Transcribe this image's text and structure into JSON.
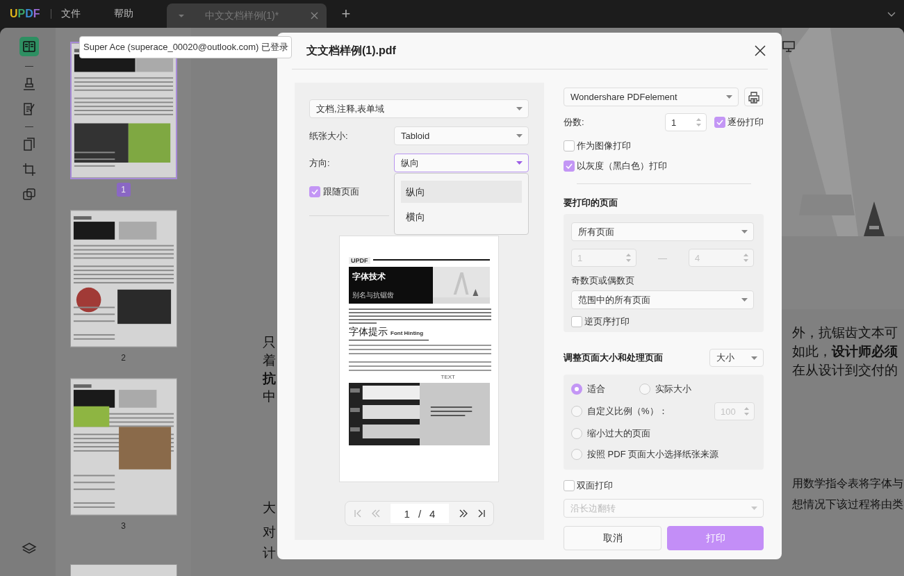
{
  "app": {
    "logo": "UPDF",
    "menu": [
      {
        "label": "文件"
      },
      {
        "label": "帮助"
      }
    ],
    "tabs": [
      {
        "label": "中文文档样例(1)*",
        "selected": true
      }
    ],
    "new_tab": "+"
  },
  "thumbnails": [
    {
      "page": "1",
      "selected": true
    },
    {
      "page": "2",
      "selected": false
    },
    {
      "page": "3",
      "selected": false
    }
  ],
  "document": {
    "left_fragments": [
      {
        "text": "只",
        "bold": false
      },
      {
        "text": "着",
        "bold": false
      },
      {
        "text": "抗",
        "bold": true
      },
      {
        "text": "中",
        "bold": false
      },
      {
        "text": "大",
        "bold": false
      },
      {
        "text": "对",
        "bold": false
      },
      {
        "text": "计",
        "bold": false
      }
    ],
    "right_fragments": [
      "外，抗锯齿文本可",
      "如此，**设计师必须**",
      "在从设计到交付的",
      "用数学指令表将字体与",
      "想情况下该过程将由类"
    ]
  },
  "tooltip": "Super Ace (superace_00020@outlook.com) 已登录",
  "dialog": {
    "title": "文文档样例(1).pdf",
    "left": {
      "content_select": "文档,注释,表单域",
      "paper_size": {
        "label": "纸张大小:",
        "value": "Tabloid"
      },
      "orientation": {
        "label": "方向:",
        "value": "纵向",
        "expanded": true,
        "options": [
          {
            "label": "纵向",
            "selected": true
          },
          {
            "label": "横向",
            "selected": false
          }
        ]
      },
      "follow_page": {
        "label": "跟随页面",
        "checked": true
      },
      "preview": {
        "logo": "UPDF",
        "title": "字体技术",
        "subtitle": "别名与抗锯齿",
        "heading": "字体提示",
        "heading_note": "Font Hinting",
        "caption": "TEXT"
      },
      "pager": {
        "current": "1",
        "separator": "/",
        "total": "4"
      }
    },
    "right": {
      "printer": "Wondershare PDFelement",
      "copies": {
        "label": "份数:",
        "value": "1"
      },
      "collate": {
        "label": "逐份打印",
        "checked": true
      },
      "options": [
        {
          "label": "作为图像打印",
          "checked": false
        },
        {
          "label": "以灰度（黑白色）打印",
          "checked": true
        }
      ],
      "pages": {
        "heading": "要打印的页面",
        "range_select": "所有页面",
        "from": "1",
        "dash": "—",
        "to": "4",
        "range_disabled": true,
        "odd_even_label": "奇数页或偶数页",
        "odd_even_select": "范围中的所有页面",
        "reverse": {
          "label": "逆页序打印",
          "checked": false
        }
      },
      "sizing": {
        "heading": "调整页面大小和处理页面",
        "mode": "大小",
        "scale": "100",
        "choices": [
          {
            "label": "适合",
            "selected": true
          },
          {
            "label": "实际大小",
            "selected": false
          },
          {
            "label": "自定义比例（%）：",
            "selected": false
          },
          {
            "label": "缩小过大的页面",
            "selected": false
          },
          {
            "label": "按照 PDF 页面大小选择纸张来源",
            "selected": false
          }
        ]
      },
      "duplex": {
        "label": "双面打印",
        "checked": false,
        "flip": "沿长边翻转"
      },
      "buttons": [
        {
          "label": "取消",
          "kind": "secondary"
        },
        {
          "label": "打印",
          "kind": "primary"
        }
      ]
    }
  }
}
